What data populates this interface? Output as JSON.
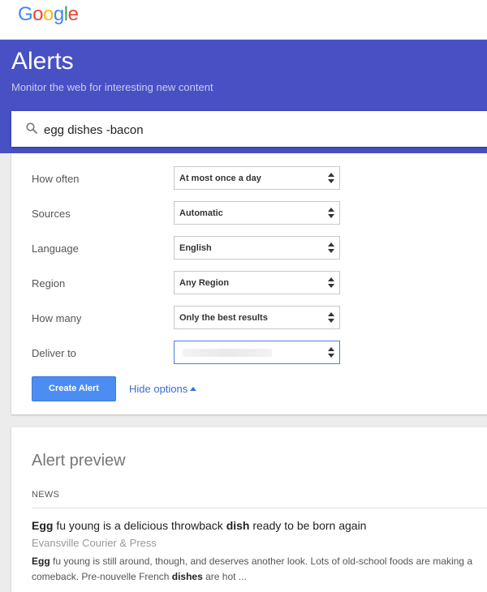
{
  "header": {
    "logo_letters": [
      {
        "ch": "G",
        "color": "#4285F4"
      },
      {
        "ch": "o",
        "color": "#EA4335"
      },
      {
        "ch": "o",
        "color": "#FBBC05"
      },
      {
        "ch": "g",
        "color": "#4285F4"
      },
      {
        "ch": "l",
        "color": "#34A853"
      },
      {
        "ch": "e",
        "color": "#EA4335"
      }
    ]
  },
  "banner": {
    "title": "Alerts",
    "subtitle": "Monitor the web for interesting new content",
    "color": "#4751C4"
  },
  "search": {
    "value": "egg dishes -bacon",
    "icon": "search-icon"
  },
  "options": [
    {
      "label": "How often",
      "value": "At most once a day"
    },
    {
      "label": "Sources",
      "value": "Automatic"
    },
    {
      "label": "Language",
      "value": "English"
    },
    {
      "label": "Region",
      "value": "Any Region"
    },
    {
      "label": "How many",
      "value": "Only the best results"
    },
    {
      "label": "Deliver to",
      "value": ""
    }
  ],
  "actions": {
    "create_label": "Create Alert",
    "hide_label": "Hide options",
    "accent": "#4B8DF3"
  },
  "preview": {
    "title": "Alert preview",
    "section_label": "NEWS",
    "item": {
      "title_parts": [
        {
          "text": "Egg",
          "bold": true
        },
        {
          "text": " fu young is a delicious throwback ",
          "bold": false
        },
        {
          "text": "dish",
          "bold": true
        },
        {
          "text": " ready to be born again",
          "bold": false
        }
      ],
      "source": "Evansville Courier & Press",
      "snippet_parts": [
        {
          "text": "Egg",
          "bold": true
        },
        {
          "text": " fu young is still around, though, and deserves another look. Lots of old-school foods are making a comeback. Pre-nouvelle French ",
          "bold": false
        },
        {
          "text": "dishes",
          "bold": true
        },
        {
          "text": " are hot ...",
          "bold": false
        }
      ]
    }
  }
}
